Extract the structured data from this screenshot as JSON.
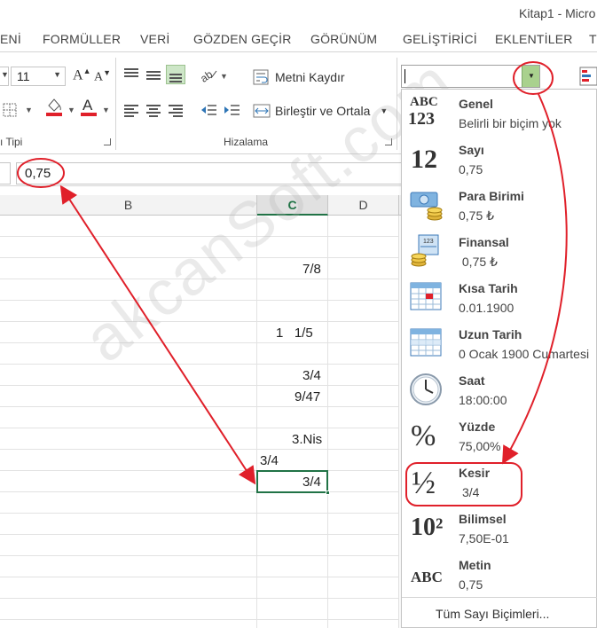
{
  "window": {
    "title": "Kitap1 - Micro"
  },
  "tabs": [
    "ENİ",
    "FORMÜLLER",
    "VERİ",
    "GÖZDEN GEÇİR",
    "GÖRÜNÜM",
    "GELİŞTİRİCİ",
    "EKLENTİLER",
    "T"
  ],
  "ribbon": {
    "font_size": "11",
    "wrap_text_label": "Metni Kaydır",
    "merge_center_label": "Birleştir ve Ortala",
    "font_group_label": "ı Tipi",
    "alignment_group_label": "Hizalama",
    "number_format_value": ""
  },
  "formula_bar": {
    "value": "0,75"
  },
  "columns": [
    "B",
    "C",
    "D"
  ],
  "cells": {
    "c_r3": "7/8",
    "c_r7": "1   1/5",
    "c_r9": "3/4",
    "c_r10": "9/47",
    "c_r12": "3.Nis",
    "b_r13": "3/4",
    "c_r14": "3/4"
  },
  "watermark": "akcanSoft.com",
  "number_format_menu": {
    "items": [
      {
        "name": "Genel",
        "example": "Belirli bir biçim yok",
        "icon": "general-format-icon",
        "icon_text": "ABC 123"
      },
      {
        "name": "Sayı",
        "example": "0,75",
        "icon": "number-format-icon",
        "icon_text": "12"
      },
      {
        "name": "Para Birimi",
        "example": "0,75 ₺",
        "icon": "currency-format-icon",
        "icon_text": ""
      },
      {
        "name": "Finansal",
        "example": " 0,75 ₺",
        "icon": "accounting-format-icon",
        "icon_text": ""
      },
      {
        "name": "Kısa Tarih",
        "example": "0.01.1900",
        "icon": "short-date-icon",
        "icon_text": ""
      },
      {
        "name": "Uzun Tarih",
        "example": "0 Ocak 1900 Cumartesi",
        "icon": "long-date-icon",
        "icon_text": ""
      },
      {
        "name": "Saat",
        "example": "18:00:00",
        "icon": "clock-icon",
        "icon_text": ""
      },
      {
        "name": "Yüzde",
        "example": "75,00%",
        "icon": "percent-icon",
        "icon_text": "%"
      },
      {
        "name": "Kesir",
        "example": "3/4",
        "icon": "fraction-icon",
        "icon_text": "½"
      },
      {
        "name": "Bilimsel",
        "example": "7,50E-01",
        "icon": "scientific-icon",
        "icon_text": "10²"
      },
      {
        "name": "Metin",
        "example": "0,75",
        "icon": "text-format-icon",
        "icon_text": "ABC"
      }
    ],
    "footer": "Tüm Sayı Biçimleri..."
  },
  "colors": {
    "accent_green": "#217346",
    "annotation_red": "#e0202a",
    "dropdown_btn_green": "#a9d18e"
  }
}
